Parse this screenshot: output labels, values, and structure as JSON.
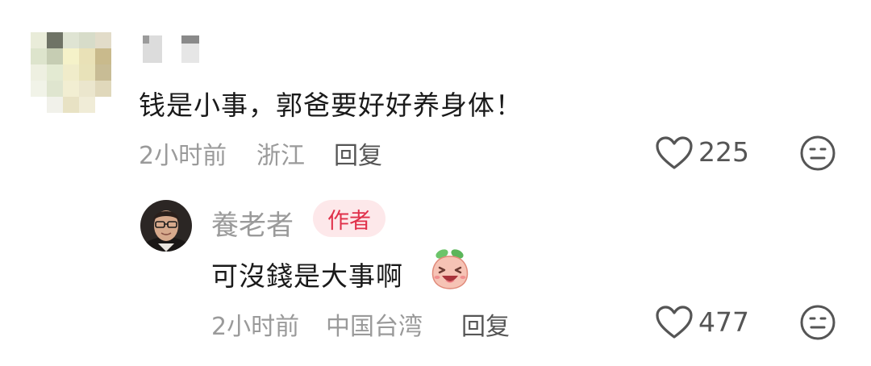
{
  "comments": [
    {
      "text": "钱是小事，郭爸要好好养身体！",
      "time": "2小时前",
      "location": "浙江",
      "reply_label": "回复",
      "like_count": "225"
    }
  ],
  "reply": {
    "author_name": "養老者",
    "badge": "作者",
    "text": "可沒錢是大事啊",
    "time": "2小时前",
    "location": "中国台湾",
    "reply_label": "回复",
    "like_count": "477"
  },
  "icons": {
    "like": "heart-outline-icon",
    "dislike": "meh-face-icon",
    "emoji": "peach-laughing-emoji"
  },
  "colors": {
    "badge_bg": "#fde8ea",
    "badge_text": "#e0304a",
    "meta": "#9a9a9a"
  }
}
